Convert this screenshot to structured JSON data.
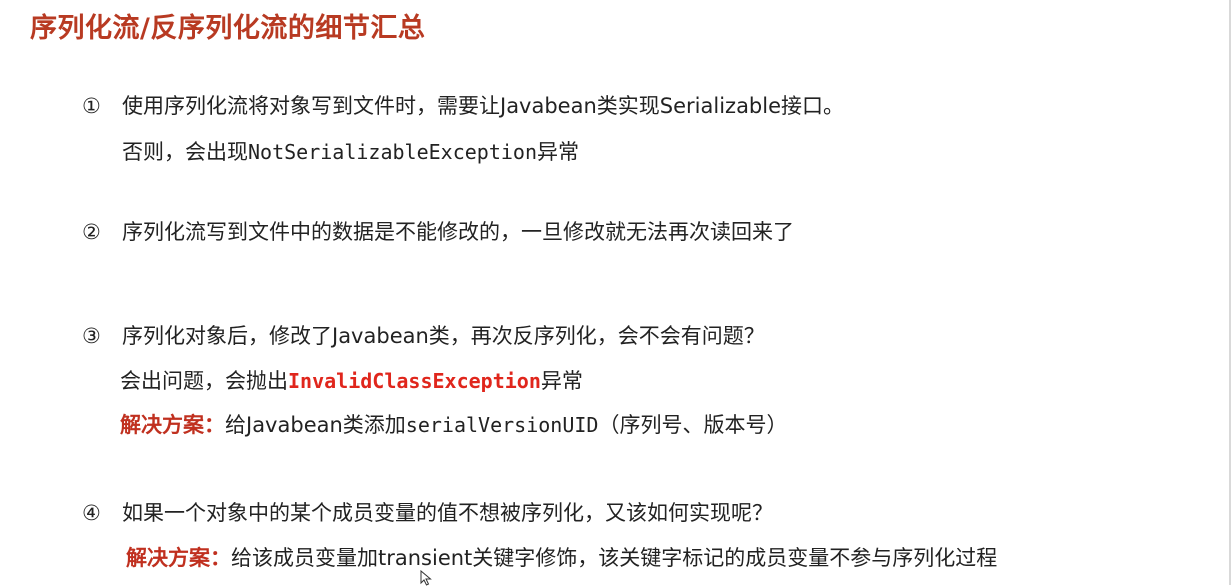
{
  "title": "序列化流/反序列化流的细节汇总",
  "items": [
    {
      "num": "①",
      "text": "使用序列化流将对象写到文件时，需要让Javabean类实现Serializable接口。",
      "sub": {
        "prefix": "否则，会出现",
        "code": "NotSerializableException",
        "suffix": "异常"
      }
    },
    {
      "num": "②",
      "text": "序列化流写到文件中的数据是不能修改的，一旦修改就无法再次读回来了"
    },
    {
      "num": "③",
      "text": "序列化对象后，修改了Javabean类，再次反序列化，会不会有问题？",
      "sub": {
        "prefix": "会出问题，会抛出",
        "code": "InvalidClassException",
        "suffix": "异常"
      },
      "solution": {
        "label": "解决方案：",
        "prefix": "给Javabean类添加",
        "code": "serialVersionUID",
        "suffix": "（序列号、版本号）"
      }
    },
    {
      "num": "④",
      "text": "如果一个对象中的某个成员变量的值不想被序列化，又该如何实现呢？",
      "solution": {
        "label": "解决方案：",
        "text": "给该成员变量加transient关键字修饰，该关键字标记的成员变量不参与序列化过程"
      }
    }
  ]
}
